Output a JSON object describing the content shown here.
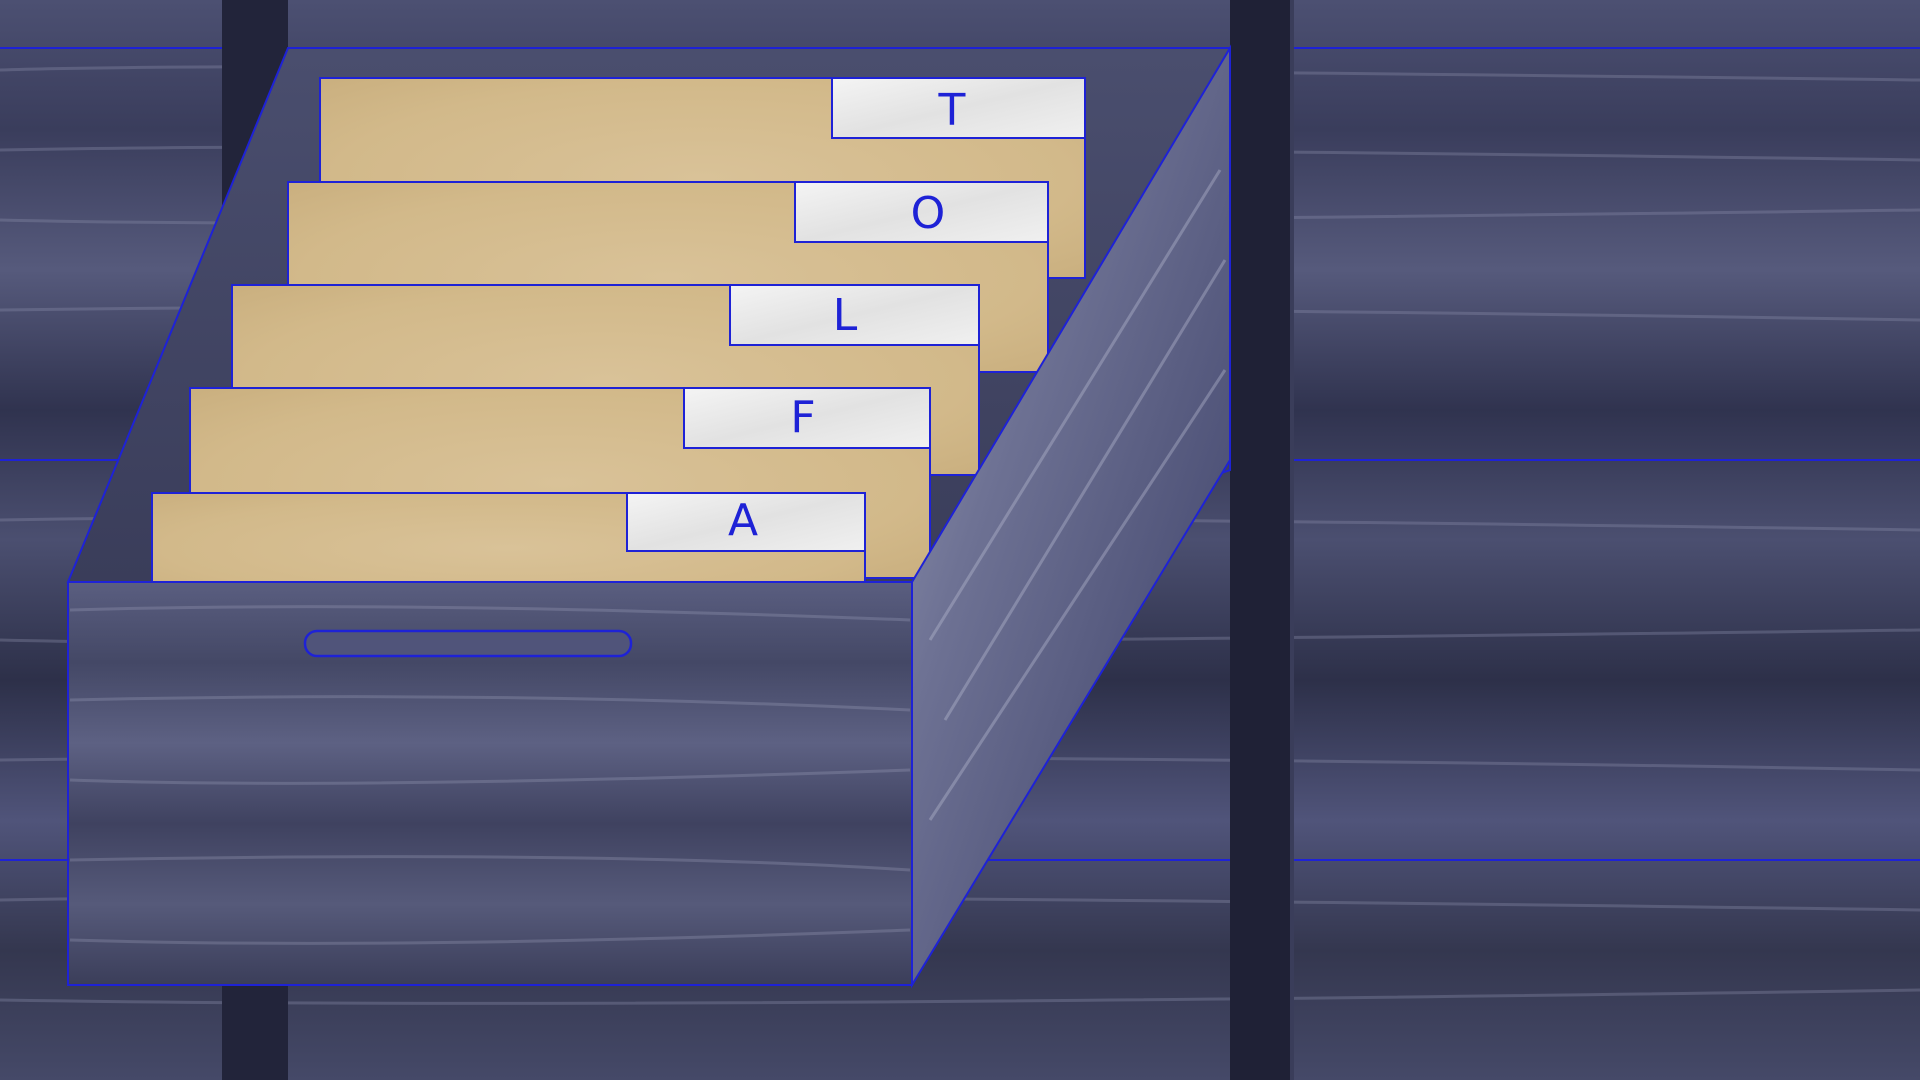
{
  "cabinet": {
    "drawer": {
      "folders": [
        {
          "tab_label": "T"
        },
        {
          "tab_label": "O"
        },
        {
          "tab_label": "L"
        },
        {
          "tab_label": "F"
        },
        {
          "tab_label": "A"
        }
      ]
    }
  },
  "colors": {
    "cabinet_dark": "#2a2d48",
    "cabinet_mid": "#4a4e70",
    "cabinet_light": "#7a7ea0",
    "folder_tan": "#d6bf92",
    "folder_tab": "#ececec",
    "outline_blue": "#1e22d6"
  }
}
